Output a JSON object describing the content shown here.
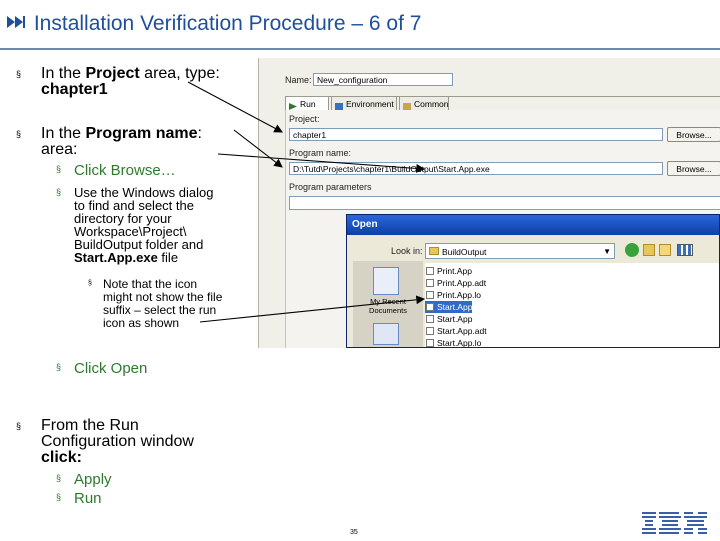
{
  "title": "Installation Verification Procedure – 6 of 7",
  "title_icon": "skip-forward-icon",
  "bullets": {
    "b1_pre": "In the ",
    "b1_bold": "Project",
    "b1_post": " area, type:",
    "b1_line2": "chapter1",
    "b2_pre": "In the ",
    "b2_bold": "Program name",
    "b2_post": ":",
    "b2_line2": "area:",
    "s1": "Click Browse…",
    "s2_l1": "Use the Windows dialog",
    "s2_l2": "to find and select the",
    "s2_l3": "directory for your",
    "s2_l4": "Workspace\\Project\\",
    "s2_l5": "BuildOutput folder and",
    "s2_l6_bold": "Start.App.exe",
    "s2_l6_post": " file",
    "n_l1": "Note that the icon",
    "n_l2": "might not show the file",
    "n_l3": "suffix – select the run",
    "n_l4": "icon as shown",
    "s3": "Click Open",
    "b3_l1": "From the Run",
    "b3_l2": "Configuration window",
    "b3_l3": "click:",
    "s4": "Apply",
    "s5": "Run"
  },
  "eclipse": {
    "name_label": "Name:",
    "name_value": "New_configuration",
    "tabs": [
      "Run",
      "Environment",
      "Common"
    ],
    "project_label": "Project:",
    "project_value": "chapter1",
    "browse1": "Browse...",
    "program_label": "Program name:",
    "program_value": "D:\\Tutd\\Projects\\chapter1\\BuildOutput\\Start.App.exe",
    "browse2": "Browse...",
    "params_label": "Program parameters"
  },
  "open_dialog": {
    "title": "Open",
    "lookin_label": "Look in:",
    "lookin_value": "BuildOutput",
    "places": [
      "My Recent Documents"
    ],
    "files": [
      "Print.App",
      "Print.App.adt",
      "Print.App.lo",
      "Start.App",
      "Start.App",
      "Start.App.adt",
      "Start.App.lo"
    ],
    "selected_index": 3
  },
  "footer": {
    "page_number": "35",
    "logo": "IBM"
  },
  "colors": {
    "title": "#1f4f9b",
    "subbullet": "#2d7a2d",
    "selection": "#316ac5"
  }
}
